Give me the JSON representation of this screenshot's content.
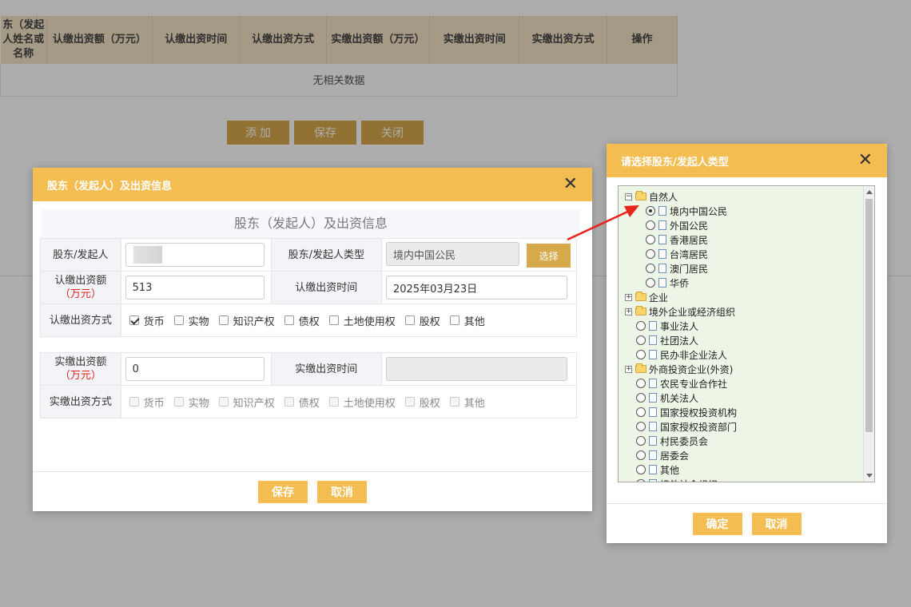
{
  "background": {
    "columns": [
      "东（发起人姓名或名称",
      "认缴出资额（万元）",
      "认缴出资时间",
      "认缴出资方式",
      "实缴出资额（万元）",
      "实缴出资时间",
      "实缴出资方式",
      "操作"
    ],
    "empty_text": "无相关数据",
    "buttons": {
      "add": "添 加",
      "save": "保存",
      "close": "关闭"
    }
  },
  "main_dialog": {
    "title": "股东（发起人）及出资信息",
    "caption": "股东（发起人）及出资信息",
    "labels": {
      "shareholder": "股东/发起人",
      "shareholder_type": "股东/发起人类型",
      "subscribed_amount": "认缴出资额",
      "subscribed_unit": "（万元）",
      "subscribed_time": "认缴出资时间",
      "subscribed_method": "认缴出资方式",
      "paid_amount": "实缴出资额",
      "paid_unit": "（万元）",
      "paid_time": "实缴出资时间",
      "paid_method": "实缴出资方式"
    },
    "values": {
      "shareholder_type": "境内中国公民",
      "subscribed_amount": "513",
      "subscribed_time": "2025年03月23日",
      "paid_amount": "0",
      "paid_time": ""
    },
    "select_label": "选择",
    "methods": [
      "货币",
      "实物",
      "知识产权",
      "债权",
      "土地使用权",
      "股权",
      "其他"
    ],
    "subscribed_checked": [
      true,
      false,
      false,
      false,
      false,
      false,
      false
    ],
    "save_label": "保存",
    "cancel_label": "取消"
  },
  "type_dialog": {
    "title": "请选择股东/发起人类型",
    "tree": [
      {
        "label": "自然人",
        "kind": "folder",
        "expand": "−",
        "level": 0
      },
      {
        "label": "境内中国公民",
        "kind": "doc",
        "level": 1,
        "selected": true
      },
      {
        "label": "外国公民",
        "kind": "doc",
        "level": 1
      },
      {
        "label": "香港居民",
        "kind": "doc",
        "level": 1
      },
      {
        "label": "台湾居民",
        "kind": "doc",
        "level": 1
      },
      {
        "label": "澳门居民",
        "kind": "doc",
        "level": 1
      },
      {
        "label": "华侨",
        "kind": "doc",
        "level": 1
      },
      {
        "label": "企业",
        "kind": "folder",
        "expand": "+",
        "level": 0
      },
      {
        "label": "境外企业或经济组织",
        "kind": "folder",
        "expand": "+",
        "level": 0
      },
      {
        "label": "事业法人",
        "kind": "doc",
        "level": 0
      },
      {
        "label": "社团法人",
        "kind": "doc",
        "level": 0
      },
      {
        "label": "民办非企业法人",
        "kind": "doc",
        "level": 0
      },
      {
        "label": "外商投资企业(外资)",
        "kind": "folder",
        "expand": "+",
        "level": 0
      },
      {
        "label": "农民专业合作社",
        "kind": "doc",
        "level": 0
      },
      {
        "label": "机关法人",
        "kind": "doc",
        "level": 0
      },
      {
        "label": "国家授权投资机构",
        "kind": "doc",
        "level": 0
      },
      {
        "label": "国家授权投资部门",
        "kind": "doc",
        "level": 0
      },
      {
        "label": "村民委员会",
        "kind": "doc",
        "level": 0
      },
      {
        "label": "居委会",
        "kind": "doc",
        "level": 0
      },
      {
        "label": "其他",
        "kind": "doc",
        "level": 0
      },
      {
        "label": "境外社会组织",
        "kind": "doc",
        "level": 0
      }
    ],
    "confirm_label": "确定",
    "cancel_label": "取消"
  },
  "colors": {
    "header": "#f4bd51",
    "button": "#d6a94b",
    "arrow": "#e8231d"
  }
}
